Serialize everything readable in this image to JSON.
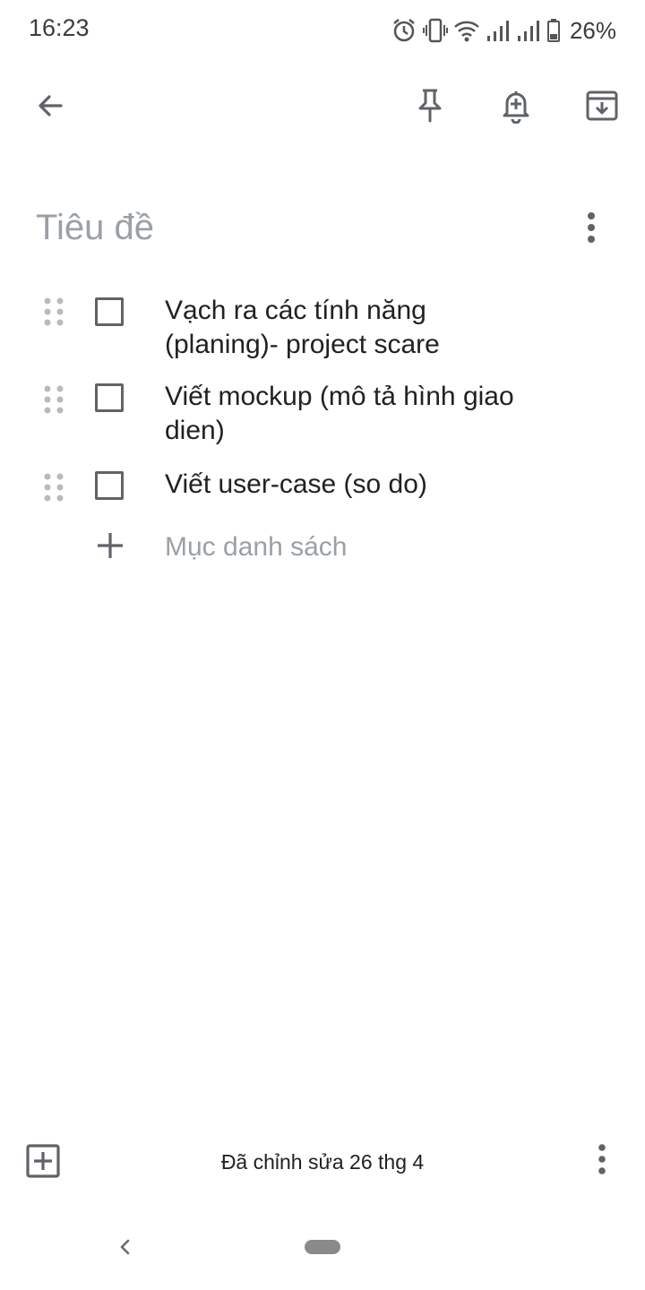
{
  "status_bar": {
    "time": "16:23",
    "battery_percent": "26%",
    "icons": [
      "alarm-icon",
      "vibrate-icon",
      "wifi-icon",
      "signal-icon",
      "signal-icon",
      "battery-icon"
    ]
  },
  "toolbar": {
    "icons": [
      "back-arrow-icon",
      "pin-icon",
      "add-reminder-icon",
      "archive-icon"
    ]
  },
  "note": {
    "title_placeholder": "Tiêu đề",
    "items": [
      {
        "text": "Vạch ra các tính năng (planing)- project scare",
        "checked": false
      },
      {
        "text": "Viết mockup (mô tả hình giao dien)",
        "checked": false
      },
      {
        "text": "Viết user-case (so do)",
        "checked": false
      }
    ],
    "add_item_label": "Mục danh sách"
  },
  "bottom_bar": {
    "edited_text": "Đã chỉnh sửa 26 thg 4"
  },
  "colors": {
    "icon": "#5f6368",
    "placeholder": "#9aa0a6",
    "text": "#202124"
  }
}
